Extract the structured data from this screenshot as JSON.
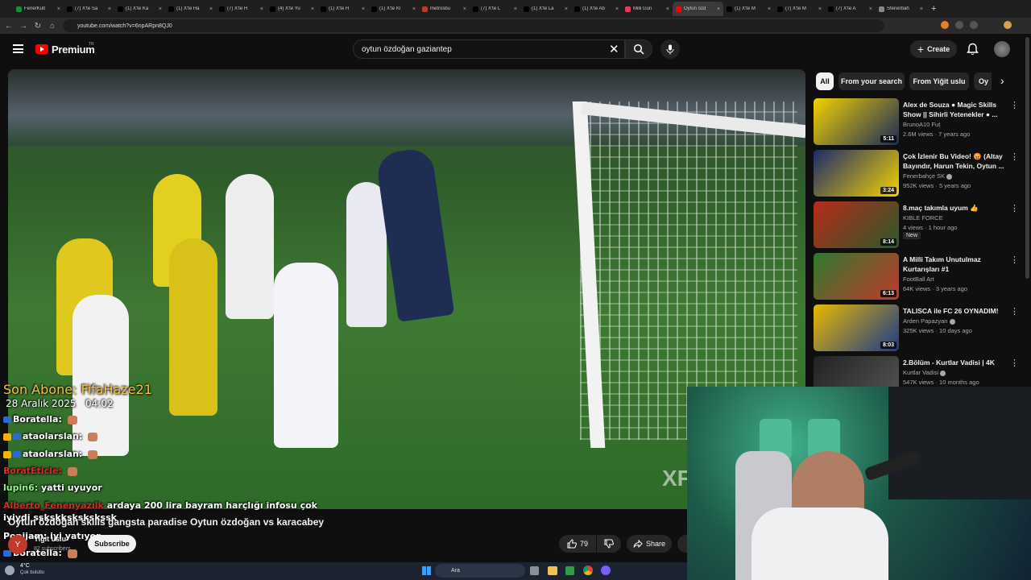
{
  "browser": {
    "tabs": [
      {
        "title": "FenerKutl",
        "color": "#1a8f3a"
      },
      {
        "title": "(7) X'te Sa",
        "color": "#000000"
      },
      {
        "title": "(1) X'te Ka",
        "color": "#000000"
      },
      {
        "title": "(1) X'te Ha",
        "color": "#000000"
      },
      {
        "title": "(7) X'te H",
        "color": "#000000"
      },
      {
        "title": "(4) X'te Yu",
        "color": "#000000"
      },
      {
        "title": "(1) X'te H",
        "color": "#000000"
      },
      {
        "title": "(1) X'te Kl",
        "color": "#000000"
      },
      {
        "title": "metrosbu",
        "color": "#c0392b"
      },
      {
        "title": "(7) X'te L",
        "color": "#000000"
      },
      {
        "title": "(1) X'te La",
        "color": "#000000"
      },
      {
        "title": "(1) X'te Ab",
        "color": "#000000"
      },
      {
        "title": "Milli Gün",
        "color": "#e8365d"
      },
      {
        "title": "Oytun özd",
        "color": "#ff0000"
      },
      {
        "title": "(1) X'te M",
        "color": "#000000"
      },
      {
        "title": "(7) X'te M",
        "color": "#000000"
      },
      {
        "title": "(7) X'te A",
        "color": "#000000"
      },
      {
        "title": "Sfenerbah",
        "color": "#888888"
      }
    ],
    "active_tab_index": 13,
    "url": "youtube.com/watch?v=6npARpn8QJ0"
  },
  "youtube": {
    "logo_text": "Premium",
    "logo_badge": "TR",
    "search_value": "oytun özdoğan gaziantep",
    "create_label": "Create",
    "chips": [
      "All",
      "From your search",
      "From Yiğit uslu",
      "Oy"
    ],
    "video": {
      "watermark": "XF",
      "title": "Oytun özdoğan skills gangsta paradise Oytun özdoğan vs karacabey",
      "channel": "Yiğit uslu",
      "subscribers": "82 subscribers",
      "avatar_letter": "Y",
      "subscribe_label": "Subscribe",
      "likes": "79",
      "share_label": "Share"
    },
    "recommendations": [
      {
        "title": "Alex de Souza ● Magic Skills Show || Sihirli Yetenekler ● ...",
        "channel": "BrunoA10 Fut",
        "meta": "2.6M views · 7 years ago",
        "duration": "5:11",
        "verified": false,
        "new": false,
        "c1": "#f3d200",
        "c2": "#1b2a5a"
      },
      {
        "title": "Çok İzlenir Bu Video! 😡 (Altay Bayındır, Harun Tekin, Oytun ...",
        "channel": "Fenerbahçe SK",
        "meta": "952K views · 5 years ago",
        "duration": "3:24",
        "verified": true,
        "new": false,
        "c1": "#1b2a6a",
        "c2": "#f3d200"
      },
      {
        "title": "8.maç takımla uyum 👍",
        "channel": "KIBLE FORCE",
        "meta": "4 views · 1 hour ago",
        "duration": "8:14",
        "verified": false,
        "new": true,
        "c1": "#b82a1a",
        "c2": "#2a5a2a"
      },
      {
        "title": "A Milli Takım Unutulmaz Kurtarışları #1",
        "channel": "FootBall Art",
        "meta": "64K views · 3 years ago",
        "duration": "6:13",
        "verified": false,
        "new": false,
        "c1": "#2f7a2f",
        "c2": "#c0392b"
      },
      {
        "title": "TALISCA ile FC 26 OYNADIM!",
        "channel": "Arden Papazyan",
        "meta": "325K views · 10 days ago",
        "duration": "8:03",
        "verified": true,
        "new": false,
        "c1": "#e8b800",
        "c2": "#1a3a8a"
      },
      {
        "title": "2.Bölüm - Kurtlar Vadisi | 4K",
        "channel": "Kurtlar Vadisi",
        "meta": "547K views · 10 months ago",
        "duration": "",
        "verified": true,
        "new": false,
        "c1": "#222222",
        "c2": "#555555"
      }
    ]
  },
  "overlay": {
    "last_sub": "Son Abone: FifaHaze21",
    "date": "28 Aralık 2025",
    "time": "04:02",
    "chat": [
      {
        "nick": "Boratella:",
        "msg": "",
        "style": "blue",
        "emo": true
      },
      {
        "nick": "ataolarslan:",
        "msg": "",
        "style": "crown",
        "emo": true
      },
      {
        "nick": "ataolarslan:",
        "msg": "",
        "style": "crown",
        "emo": true
      },
      {
        "nick": "BoratEticle:",
        "msg": "",
        "style": "red",
        "emo": true
      },
      {
        "nick": "lupin6:",
        "msg": "yatti uyuyor",
        "style": "green",
        "emo": false
      },
      {
        "nick": "Alberto_Fenenyazılk",
        "msg": "ardaya 200 lira bayram harçlığı infosu çok",
        "style": "red",
        "emo": false
      },
      {
        "nick": "",
        "msg": "iyiydi sskskkskskskssk",
        "style": "plain",
        "emo": false
      },
      {
        "nick": "Popijam:",
        "msg": "iyi yatıyor",
        "style": "plain",
        "emo": false
      },
      {
        "nick": "Boratella:",
        "msg": "",
        "style": "blue",
        "emo": true
      }
    ]
  },
  "taskbar": {
    "weather": "4°C",
    "weather_sub": "Çok bulutlu",
    "search_label": "Ara"
  }
}
